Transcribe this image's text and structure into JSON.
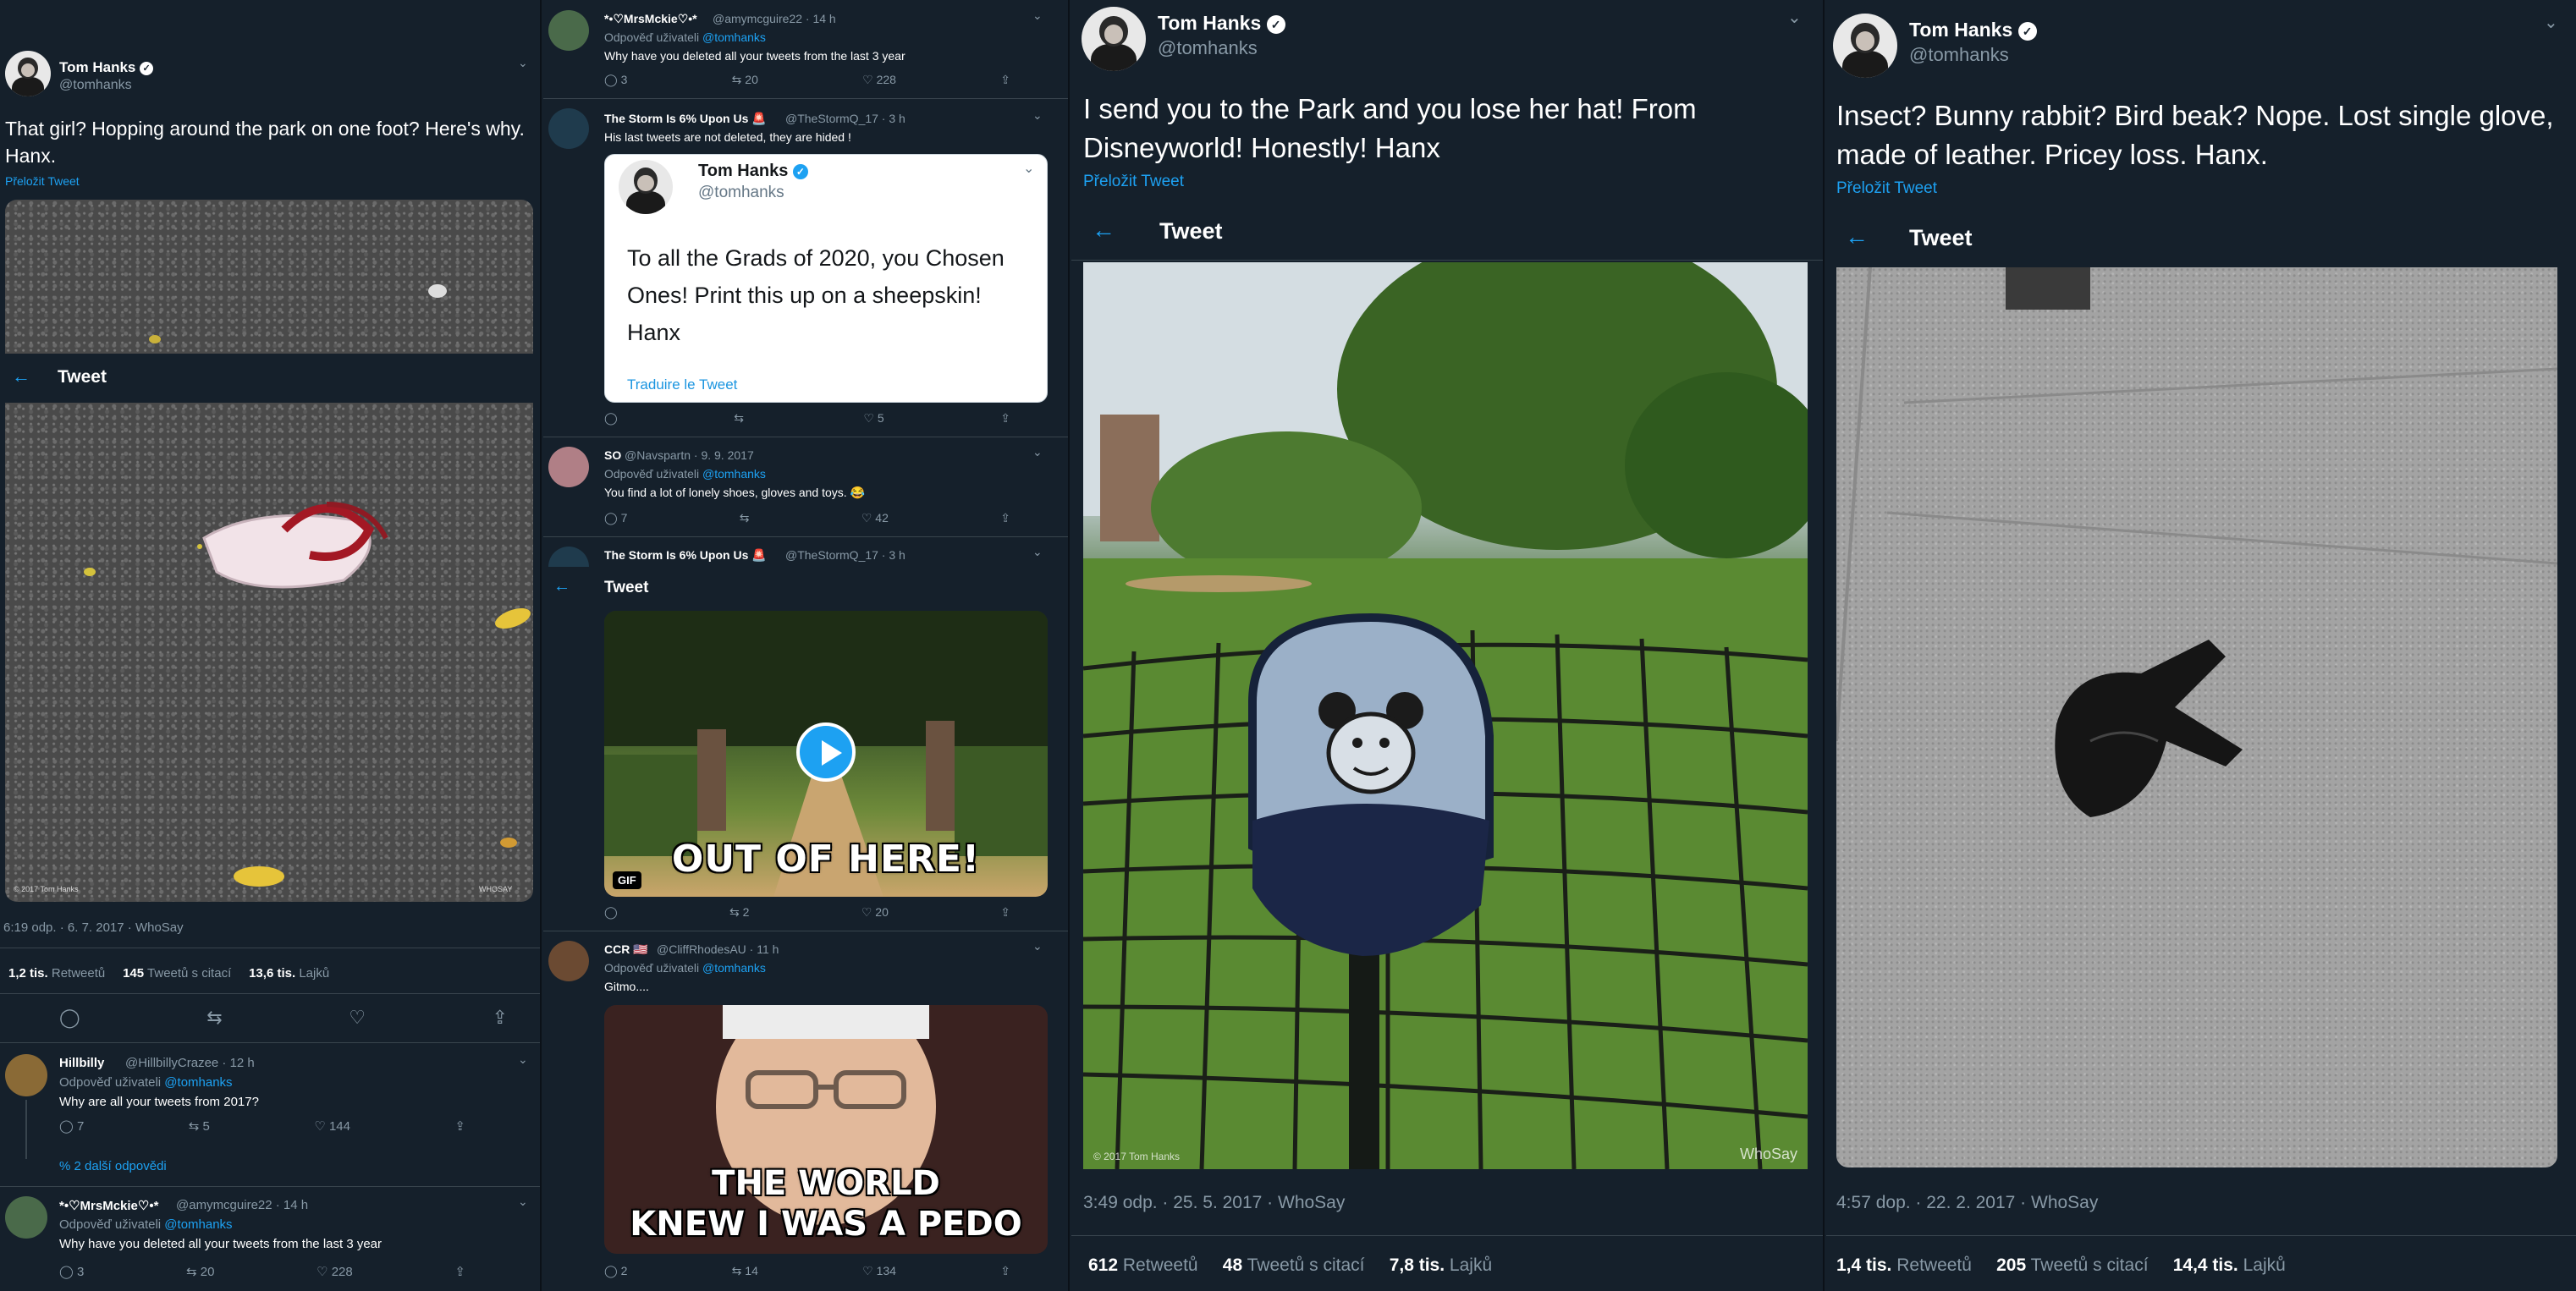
{
  "colors": {
    "background": "#15202b",
    "accent": "#1da1f2",
    "muted": "#8899a6",
    "divider": "#38444d"
  },
  "panel1": {
    "author": {
      "name": "Tom Hanks",
      "handle": "@tomhanks"
    },
    "tweet_text": "That girl? Hopping around the park on one foot? Here's why. Hanx.",
    "translate": "Přeložit Tweet",
    "back_bar": {
      "title": "Tweet"
    },
    "photo_credit": "© 2017 Tom Hanks",
    "photo_watermark": "WHOSAY",
    "timestamp": "6:19 odp. · 6. 7. 2017 · WhoSay",
    "stats": {
      "retweets": "1,2 tis.",
      "retweets_label": "Retweetů",
      "quotes": "145",
      "quotes_label": "Tweetů s citací",
      "likes": "13,6 tis.",
      "likes_label": "Lajků"
    },
    "replies": [
      {
        "name": "Hillbilly",
        "handle": "@HillbillyCrazee · 12 h",
        "reply_to_label": "Odpověď uživateli",
        "reply_to": "@tomhanks",
        "text": "Why are all your tweets from 2017?",
        "replies": "7",
        "retweets": "5",
        "likes": "144"
      },
      {
        "name": "*•♡MrsMckie♡•*",
        "handle": "@amymcguire22 · 14 h",
        "reply_to_label": "Odpověď uživateli",
        "reply_to": "@tomhanks",
        "text": "Why have you deleted all your tweets from the last 3 year",
        "replies": "3",
        "retweets": "20",
        "likes": "228"
      }
    ],
    "more_replies": "% 2 další odpovědi"
  },
  "panel2": {
    "items": [
      {
        "name": "*•♡MrsMckie♡•*",
        "handle": "@amymcguire22 · 14 h",
        "reply_to_label": "Odpověď uživateli",
        "reply_to": "@tomhanks",
        "text": "Why have you deleted all your tweets from the last 3 year",
        "replies": "3",
        "retweets": "20",
        "likes": "228"
      },
      {
        "name": "The Storm Is 6% Upon Us 🚨",
        "handle": "@TheStormQ_17 · 3 h",
        "text": "His last tweets are not deleted, they are hided !",
        "retweets": "",
        "likes": "5"
      },
      {
        "name": "SO",
        "handle": "@Navspartn · 9. 9. 2017",
        "reply_to_label": "Odpověď uživateli",
        "reply_to": "@tomhanks",
        "text": "You find a lot of lonely shoes, gloves and toys. 😂",
        "replies": "7",
        "retweets": "",
        "likes": "42"
      },
      {
        "name": "The Storm Is 6% Upon Us 🚨",
        "handle": "@TheStormQ_17 · 3 h",
        "replies": "",
        "retweets": "2",
        "likes": "20"
      },
      {
        "name": "CCR 🇺🇸",
        "handle": "@CliffRhodesAU · 11 h",
        "reply_to_label": "Odpověď uživateli",
        "reply_to": "@tomhanks",
        "text": "Gitmo....",
        "replies": "2",
        "retweets": "14",
        "likes": "134"
      }
    ],
    "quoted": {
      "name": "Tom Hanks",
      "handle": "@tomhanks",
      "text": "To all the Grads of 2020, you Chosen Ones!  Print this up on a sheepskin!  Hanx",
      "translate": "Traduire le Tweet"
    },
    "back_bar": {
      "title": "Tweet"
    },
    "gif": {
      "caption": "OUT OF HERE!",
      "badge": "GIF"
    },
    "meme": {
      "line1": "THE WORLD",
      "line2": "KNEW I WAS A PEDO"
    }
  },
  "panel3": {
    "author": {
      "name": "Tom Hanks",
      "handle": "@tomhanks"
    },
    "tweet_text": "I send you to the Park and you lose her hat!  From Disneyworld!  Honestly!  Hanx",
    "translate": "Přeložit Tweet",
    "back_bar": {
      "title": "Tweet"
    },
    "photo_credit": "© 2017 Tom Hanks",
    "photo_watermark": "WhoSay",
    "timestamp": "3:49 odp. · 25. 5. 2017 · WhoSay",
    "stats": {
      "retweets": "612",
      "retweets_label": "Retweetů",
      "quotes": "48",
      "quotes_label": "Tweetů s citací",
      "likes": "7,8 tis.",
      "likes_label": "Lajků"
    }
  },
  "panel4": {
    "author": {
      "name": "Tom Hanks",
      "handle": "@tomhanks"
    },
    "tweet_text": "Insect? Bunny rabbit? Bird beak? Nope. Lost single glove, made of leather. Pricey loss. Hanx.",
    "translate": "Přeložit Tweet",
    "back_bar": {
      "title": "Tweet"
    },
    "timestamp": "4:57 dop. · 22. 2. 2017 · WhoSay",
    "stats": {
      "retweets": "1,4 tis.",
      "retweets_label": "Retweetů",
      "quotes": "205",
      "quotes_label": "Tweetů s citací",
      "likes": "14,4 tis.",
      "likes_label": "Lajků"
    }
  },
  "icons": [
    "back-arrow-icon",
    "chevron-down-icon",
    "verified-badge-icon",
    "reply-icon",
    "retweet-icon",
    "like-icon",
    "share-icon",
    "play-icon"
  ]
}
